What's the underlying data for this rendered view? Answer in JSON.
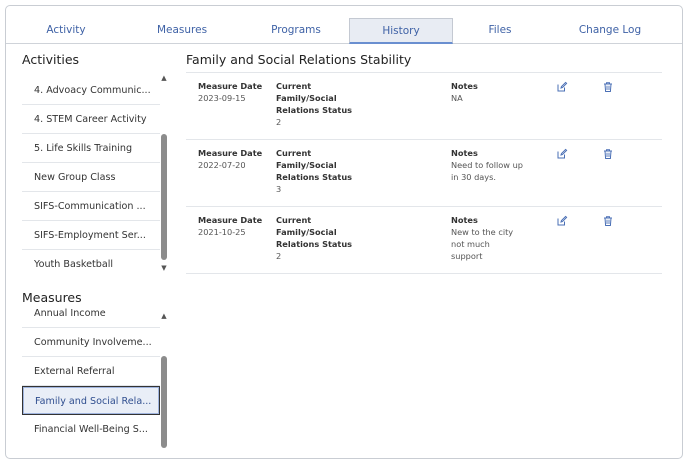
{
  "tabs": [
    {
      "label": "Activity"
    },
    {
      "label": "Measures"
    },
    {
      "label": "Programs"
    },
    {
      "label": "History"
    },
    {
      "label": "Files"
    },
    {
      "label": "Change Log"
    }
  ],
  "active_tab": "History",
  "activities": {
    "title": "Activities",
    "items": [
      {
        "label": "4. Advoacy Communic..."
      },
      {
        "label": "4. STEM Career Activity"
      },
      {
        "label": "5. Life Skills Training"
      },
      {
        "label": "New Group Class"
      },
      {
        "label": "SIFS-Communication ..."
      },
      {
        "label": "SIFS-Employment Ser..."
      },
      {
        "label": "Youth Basketball"
      }
    ]
  },
  "measures": {
    "title": "Measures",
    "items": [
      {
        "label": "Annual Income"
      },
      {
        "label": "Community Involveme..."
      },
      {
        "label": "External Referral"
      },
      {
        "label": "Family and Social Rela..."
      },
      {
        "label": "Financial Well-Being S..."
      }
    ],
    "selected": "Family and Social Rela..."
  },
  "history": {
    "title": "Family and Social Relations Stability",
    "labels": {
      "date": "Measure Date",
      "status_1": "Current",
      "status_2": "Family/Social",
      "status_3": "Relations Status",
      "notes": "Notes"
    },
    "records": [
      {
        "date": "2023-09-15",
        "status": "2",
        "notes": [
          "NA"
        ]
      },
      {
        "date": "2022-07-20",
        "status": "3",
        "notes": [
          "Need to follow up",
          "in 30 days."
        ]
      },
      {
        "date": "2021-10-25",
        "status": "2",
        "notes": [
          "New to the city",
          "not much",
          "support"
        ]
      }
    ],
    "icons": {
      "edit": "edit-icon",
      "delete": "trash-icon"
    },
    "icon_color": "#4a6fb5"
  }
}
